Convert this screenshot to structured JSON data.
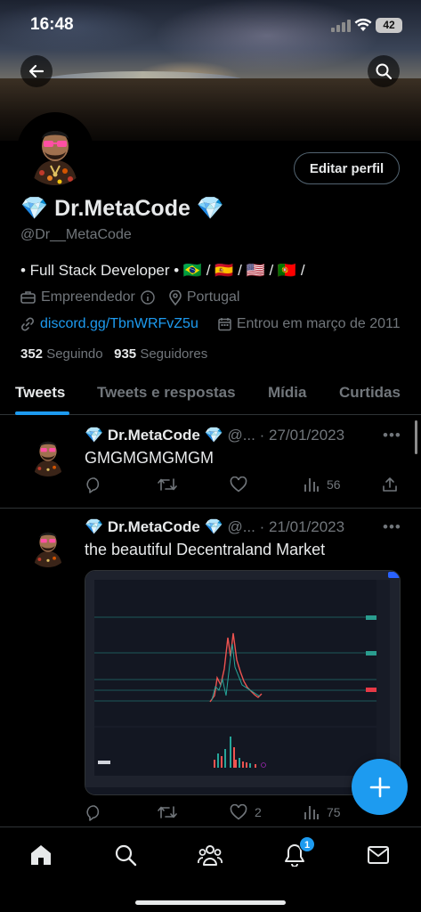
{
  "status_bar": {
    "time": "16:48",
    "battery": "42"
  },
  "profile": {
    "name": "💎 Dr.MetaCode 💎",
    "handle": "@Dr__MetaCode",
    "edit_button": "Editar perfil",
    "bio": "• Full Stack Developer • 🇧🇷 / 🇪🇸 / 🇺🇸 / 🇵🇹 /",
    "category": "Empreendedor",
    "location": "Portugal",
    "website": "discord.gg/TbnWRFvZ5u",
    "joined": "Entrou em março de 2011",
    "following_count": "352",
    "following_label": "Seguindo",
    "followers_count": "935",
    "followers_label": "Seguidores"
  },
  "tabs": [
    {
      "label": "Tweets",
      "active": true
    },
    {
      "label": "Tweets e respostas",
      "active": false
    },
    {
      "label": "Mídia",
      "active": false
    },
    {
      "label": "Curtidas",
      "active": false
    }
  ],
  "tweets": [
    {
      "author": "💎 Dr.MetaCode 💎",
      "handle": "@...",
      "date": "· 27/01/2023",
      "text": "GMGMGMGMGM",
      "likes": "",
      "views": "56"
    },
    {
      "author": "💎 Dr.MetaCode 💎",
      "handle": "@...",
      "date": "· 21/01/2023",
      "text": "the beautiful Decentraland Market",
      "likes": "2",
      "views": "75"
    }
  ],
  "notifications_badge": "1",
  "colors": {
    "accent": "#1d9bf0",
    "background": "#000000",
    "muted": "#71767b"
  },
  "icons": [
    "back-arrow-icon",
    "search-icon",
    "briefcase-icon",
    "info-icon",
    "location-pin-icon",
    "link-icon",
    "calendar-icon",
    "reply-icon",
    "retweet-icon",
    "like-icon",
    "views-icon",
    "share-icon",
    "compose-plus-icon",
    "home-icon",
    "people-icon",
    "bell-icon",
    "mail-icon"
  ]
}
